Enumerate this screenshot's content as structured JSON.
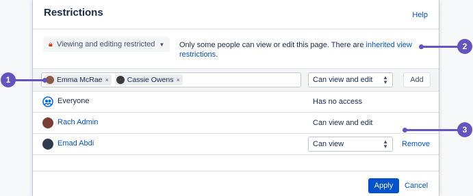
{
  "dialog": {
    "title": "Restrictions",
    "help": "Help",
    "restriction_mode": "Viewing and editing restricted",
    "description_prefix": "Only some people can view or edit this page. There are ",
    "description_link": "inherited view restrictions",
    "description_suffix": "."
  },
  "add_row": {
    "chips": [
      {
        "label": "Emma McRae",
        "remove": "×"
      },
      {
        "label": "Cassie Owens",
        "remove": "×"
      }
    ],
    "permission": "Can view and edit",
    "add_button": "Add"
  },
  "entries": [
    {
      "name": "Everyone",
      "permission": "Has no access"
    },
    {
      "name": "Rach Admin",
      "permission": "Can view and edit"
    },
    {
      "name": "Emad Abdi",
      "permission": "Can view",
      "remove": "Remove"
    }
  ],
  "footer": {
    "apply": "Apply",
    "cancel": "Cancel"
  },
  "callouts": [
    "1",
    "2",
    "3"
  ],
  "colors": {
    "accent": "#0052cc",
    "callout": "#6554c0",
    "lock": "#de350b"
  }
}
